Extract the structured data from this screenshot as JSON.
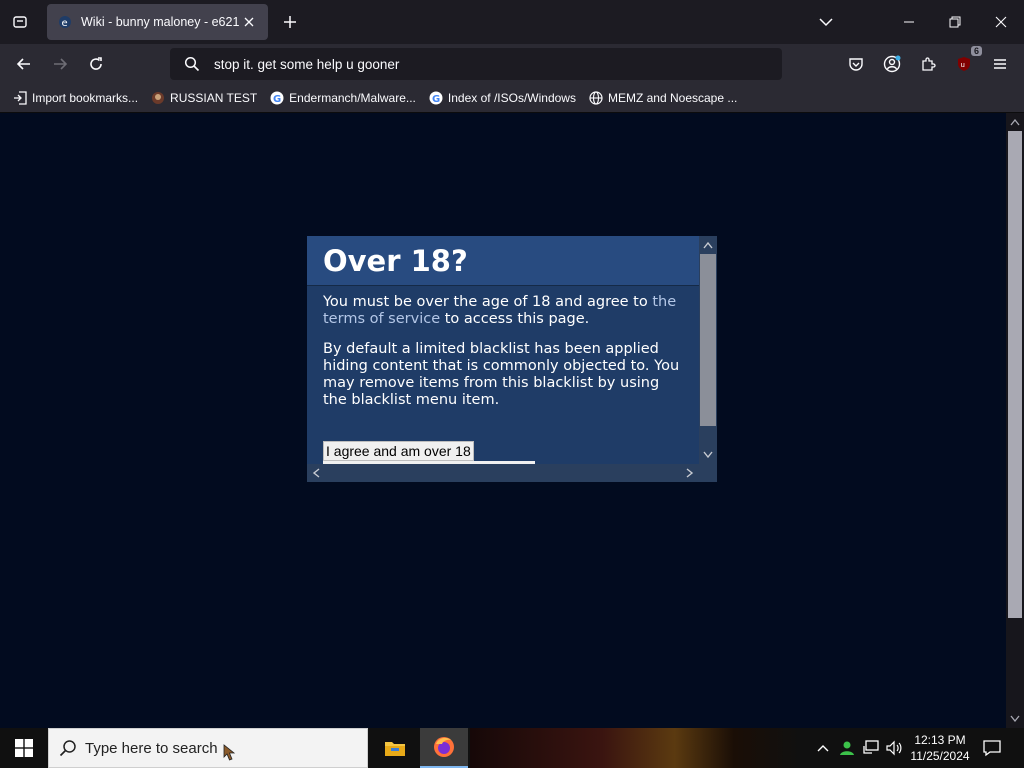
{
  "browser": {
    "tab": {
      "title": "Wiki - bunny maloney - e621"
    },
    "url": "stop it. get some help u gooner",
    "extensions_badge": "6"
  },
  "bookmarks": [
    {
      "label": "Import bookmarks...",
      "icon": "import-icon"
    },
    {
      "label": "RUSSIAN TEST",
      "icon": "russian-test-favicon"
    },
    {
      "label": "Endermanch/Malware...",
      "icon": "google-favicon"
    },
    {
      "label": "Index of /ISOs/Windows",
      "icon": "google-favicon"
    },
    {
      "label": "MEMZ and Noescape ...",
      "icon": "globe-icon"
    }
  ],
  "modal": {
    "title": "Over 18?",
    "p1_before": "You must be over the age of 18 and agree to ",
    "p1_link": "the terms of service",
    "p1_after": " to access this page.",
    "p2": "By default a limited blacklist has been applied hiding content that is commonly objected to. You may remove items from this blacklist by using the blacklist menu item.",
    "agree_button": "I agree and am over 18"
  },
  "taskbar": {
    "search_placeholder": "Type here to search",
    "time": "12:13 PM",
    "date": "11/25/2024"
  },
  "colors": {
    "page_bg": "#020b1f",
    "modal_bg": "#1f3c67",
    "modal_header": "#284b80",
    "link": "#b4c7e7"
  }
}
